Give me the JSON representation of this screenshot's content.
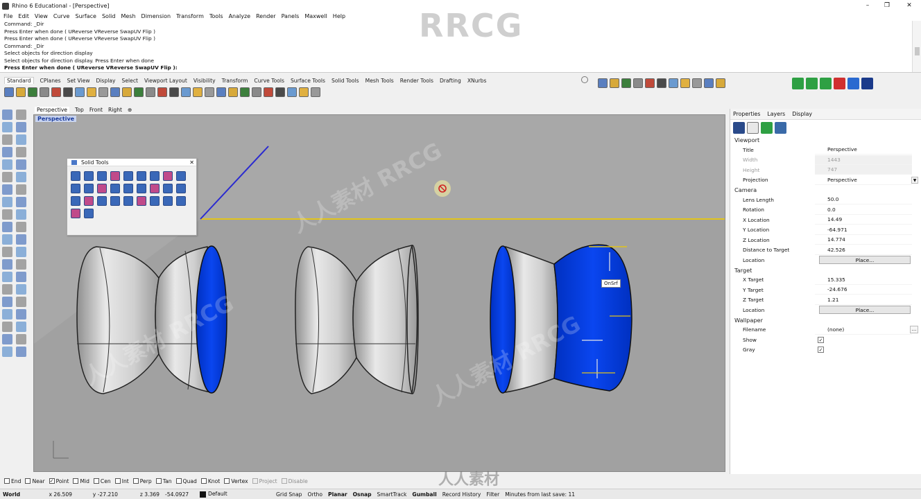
{
  "app": {
    "title": "Rhino 6 Educational - [Perspective]",
    "window_controls": [
      "–",
      "❐",
      "✕"
    ],
    "menu": [
      "File",
      "Edit",
      "View",
      "Curve",
      "Surface",
      "Solid",
      "Mesh",
      "Dimension",
      "Transform",
      "Tools",
      "Analyze",
      "Render",
      "Panels",
      "Maxwell",
      "Help"
    ]
  },
  "watermarks": {
    "brand": "RRCG",
    "footer": "人人素材",
    "tiled": "人人素材 RRCG"
  },
  "command_history": [
    "Command: _Dir",
    "Press Enter when done ( UReverse  VReverse  SwapUV  Flip )",
    "Press Enter when done ( UReverse  VReverse  SwapUV  Flip )",
    "Command: _Dir",
    "Select objects for direction display",
    "Select objects for direction display. Press Enter when done"
  ],
  "command_prompt": "Press Enter when done ( UReverse  VReverse  SwapUV  Flip ):",
  "toolbar_tabs": [
    "Standard",
    "CPlanes",
    "Set View",
    "Display",
    "Select",
    "Viewport Layout",
    "Visibility",
    "Transform",
    "Curve Tools",
    "Surface Tools",
    "Solid Tools",
    "Mesh Tools",
    "Render Tools",
    "Drafting",
    "XNurbs"
  ],
  "toolbar_tab_active": "Standard",
  "icon_names": {
    "standard": [
      "new-file-icon",
      "open-file-icon",
      "save-icon",
      "print-icon",
      "import-icon",
      "cut-icon",
      "copy-icon",
      "paste-icon",
      "undo-icon",
      "pan-icon",
      "rotate-view-icon",
      "zoom-icon",
      "zoom-window-icon",
      "zoom-extents-icon",
      "zoom-selected-icon",
      "four-viewports-icon",
      "grid-icon",
      "lock-icon",
      "hide-icon",
      "show-icon",
      "light-icon",
      "material-icon",
      "render-icon",
      "sphere-render-icon",
      "lens-flare-icon",
      "filter-icon",
      "help-icon"
    ],
    "right_group": [
      "check-icon",
      "orbit-icon",
      "display-mode-icon",
      "rectangle-view-icon",
      "snap-icon",
      "rotate-3d-icon",
      "mirror-icon",
      "plant-icon",
      "ghost-icon",
      "eraser-icon",
      "target-icon"
    ],
    "plugins": [
      "vray-icon",
      "vray-render-icon",
      "vray-frame-icon",
      "record-icon",
      "swap-icon",
      "save-disk-icon"
    ]
  },
  "viewport_tabs": [
    "Perspective",
    "Top",
    "Front",
    "Right"
  ],
  "viewport_label": "Perspective",
  "solid_tools_panel": {
    "title": "Solid Tools",
    "icon_count": 29
  },
  "viewport_tag": "OnSrf",
  "right_panel": {
    "tabs": [
      "Properties",
      "Layers",
      "Display"
    ],
    "sections": {
      "viewport": "Viewport",
      "camera": "Camera",
      "target": "Target",
      "wallpaper": "Wallpaper"
    },
    "viewport_props": [
      {
        "k": "Title",
        "v": "Perspective",
        "disabled": false
      },
      {
        "k": "Width",
        "v": "1443",
        "disabled": true
      },
      {
        "k": "Height",
        "v": "747",
        "disabled": true
      },
      {
        "k": "Projection",
        "v": "Perspective",
        "disabled": false
      }
    ],
    "camera_props": [
      {
        "k": "Lens Length",
        "v": "50.0"
      },
      {
        "k": "Rotation",
        "v": "0.0"
      },
      {
        "k": "X Location",
        "v": "14.49"
      },
      {
        "k": "Y Location",
        "v": "-64.971"
      },
      {
        "k": "Z Location",
        "v": "14.774"
      },
      {
        "k": "Distance to Target",
        "v": "42.526"
      }
    ],
    "camera_location": {
      "k": "Location",
      "button": "Place..."
    },
    "target_props": [
      {
        "k": "X Target",
        "v": "15.335"
      },
      {
        "k": "Y Target",
        "v": "-24.676"
      },
      {
        "k": "Z Target",
        "v": "1.21"
      }
    ],
    "target_location": {
      "k": "Location",
      "button": "Place..."
    },
    "wallpaper": {
      "filename_k": "Filename",
      "filename_v": "(none)",
      "show_k": "Show",
      "show_checked": true,
      "gray_k": "Gray",
      "gray_checked": true,
      "dots": "..."
    }
  },
  "osnaps": [
    {
      "label": "End",
      "checked": false,
      "dim": false
    },
    {
      "label": "Near",
      "checked": false,
      "dim": false
    },
    {
      "label": "Point",
      "checked": true,
      "dim": false
    },
    {
      "label": "Mid",
      "checked": false,
      "dim": false
    },
    {
      "label": "Cen",
      "checked": false,
      "dim": false
    },
    {
      "label": "Int",
      "checked": false,
      "dim": false
    },
    {
      "label": "Perp",
      "checked": false,
      "dim": false
    },
    {
      "label": "Tan",
      "checked": false,
      "dim": false
    },
    {
      "label": "Quad",
      "checked": false,
      "dim": false
    },
    {
      "label": "Knot",
      "checked": false,
      "dim": false
    },
    {
      "label": "Vertex",
      "checked": false,
      "dim": false
    },
    {
      "label": "Project",
      "checked": false,
      "dim": true
    },
    {
      "label": "Disable",
      "checked": false,
      "dim": true
    }
  ],
  "status": {
    "cplane": "World",
    "x": "x 26.509",
    "y": "y -27.210",
    "z": "z 3.369",
    "extra": "-54.0927",
    "layer": "Default",
    "toggles": [
      {
        "label": "Grid Snap",
        "bold": false
      },
      {
        "label": "Ortho",
        "bold": false
      },
      {
        "label": "Planar",
        "bold": true
      },
      {
        "label": "Osnap",
        "bold": true
      },
      {
        "label": "SmartTrack",
        "bold": false
      },
      {
        "label": "Gumball",
        "bold": true
      },
      {
        "label": "Record History",
        "bold": false
      },
      {
        "label": "Filter",
        "bold": false
      }
    ],
    "save_info": "Minutes from last save: 11"
  },
  "colors": {
    "accent_blue": "#0a3fe0",
    "surface_gray": "#c9c9c9",
    "viewport_bg": "#a6a6a6",
    "x_axis": "#e0c020",
    "y_axis": "#3030c8"
  }
}
